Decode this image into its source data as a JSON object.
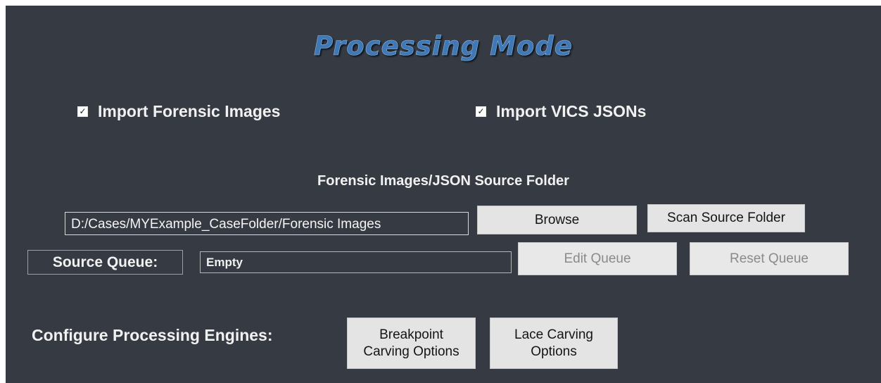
{
  "title": "Processing Mode",
  "import_options": [
    {
      "label": "Import Forensic Images",
      "checked": true
    },
    {
      "label": "Import VICS JSONs",
      "checked": true
    }
  ],
  "checkbox_glyph": "✓",
  "source": {
    "heading": "Forensic Images/JSON Source Folder",
    "path_value": "D:/Cases/MYExample_CaseFolder/Forensic Images",
    "browse_label": "Browse",
    "scan_label": "Scan Source Folder"
  },
  "queue": {
    "label": "Source Queue:",
    "value": "Empty",
    "edit_label": "Edit Queue",
    "edit_enabled": false,
    "reset_label": "Reset Queue",
    "reset_enabled": false
  },
  "engines": {
    "label": "Configure Processing Engines:",
    "breakpoint_line1": "Breakpoint",
    "breakpoint_line2": "Carving Options",
    "lace_line1": "Lace Carving",
    "lace_line2": "Options"
  },
  "colors": {
    "panel_bg": "#363a42",
    "title_blue": "#3f78b4",
    "text": "#f1f1f1",
    "button_bg": "#e4e4e4",
    "disabled_text": "#8a8a8a"
  }
}
